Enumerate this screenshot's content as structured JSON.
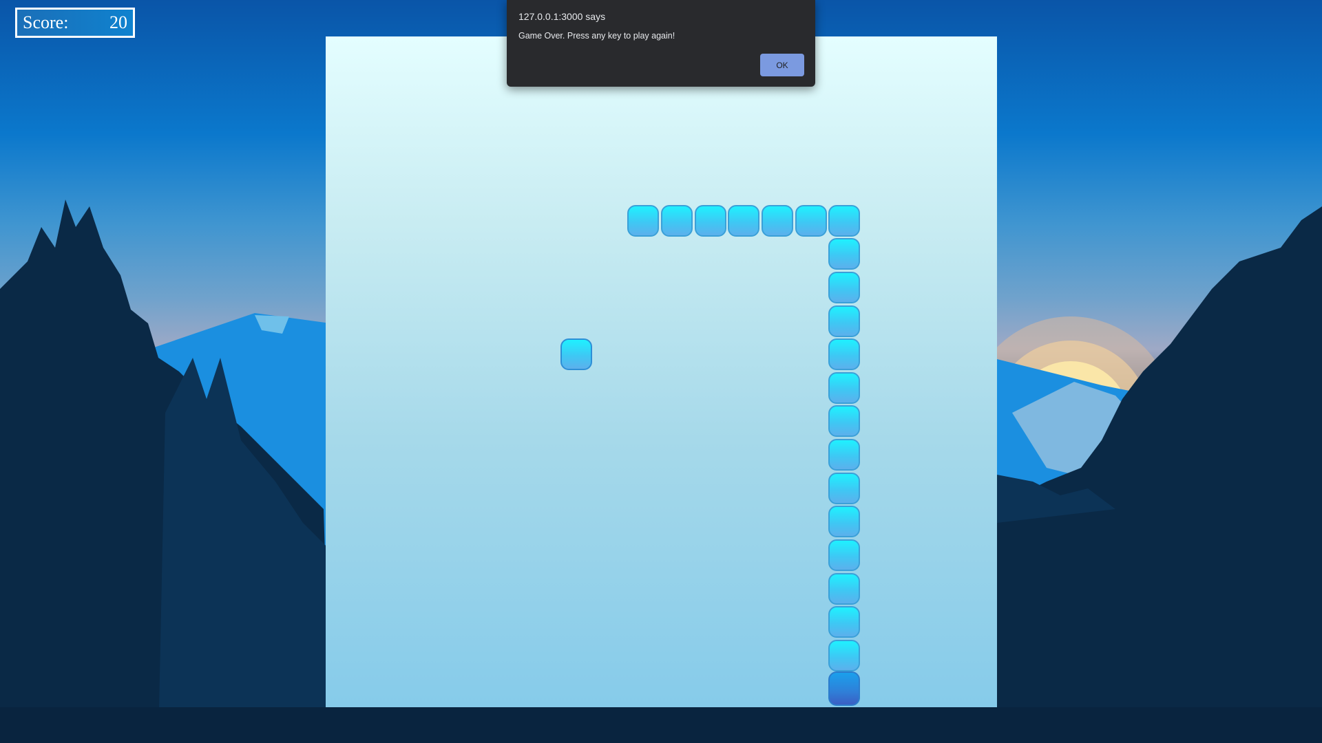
{
  "score": {
    "label": "Score:",
    "value": "20"
  },
  "dialog": {
    "title": "127.0.0.1:3000 says",
    "message": "Game Over. Press any key to play again!",
    "ok_label": "OK"
  },
  "game": {
    "snake_length": 21,
    "food_count": 1
  },
  "colors": {
    "snake_body": "#29dcf9",
    "snake_head": "#2f7fd8",
    "board_top": "#e4feff",
    "board_bottom": "#86cbea",
    "dialog_bg": "#292a2d",
    "ok_button": "#7b9ae0",
    "forest_silhouette": "#0a2946"
  }
}
